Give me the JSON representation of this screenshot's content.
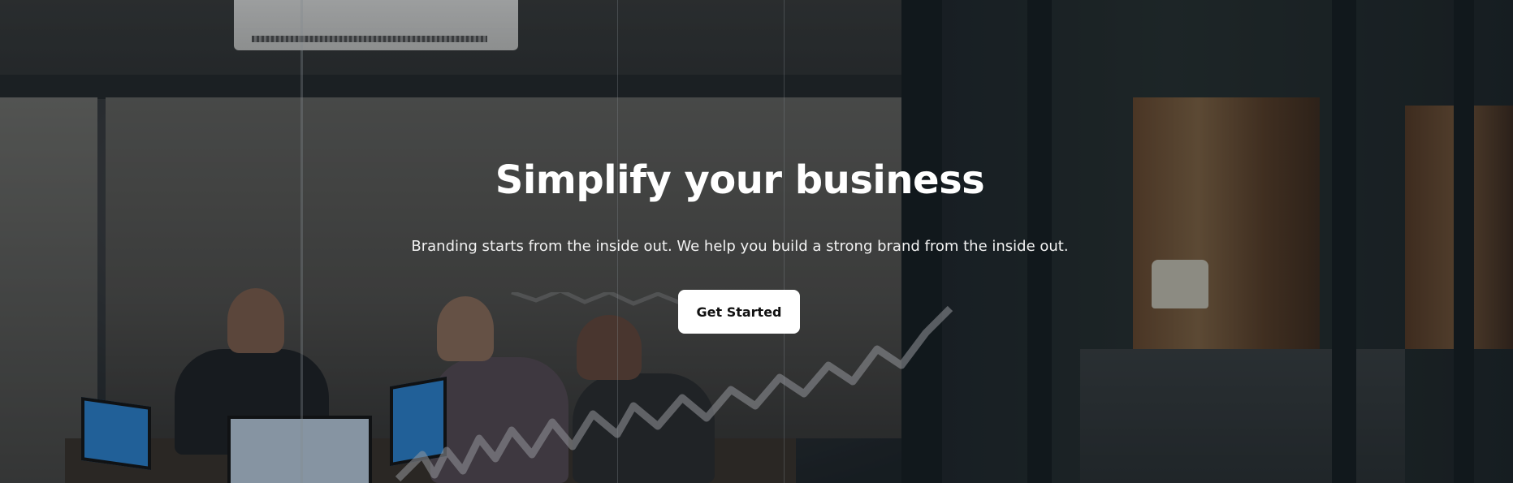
{
  "hero": {
    "title": "Simplify your business",
    "subtitle": "Branding starts from the inside out. We help you build a strong brand from the inside out.",
    "cta_label": "Get Started",
    "overlay_color": "#0f161a",
    "button_color": "#ffffff",
    "text_color": "#ffffff"
  }
}
